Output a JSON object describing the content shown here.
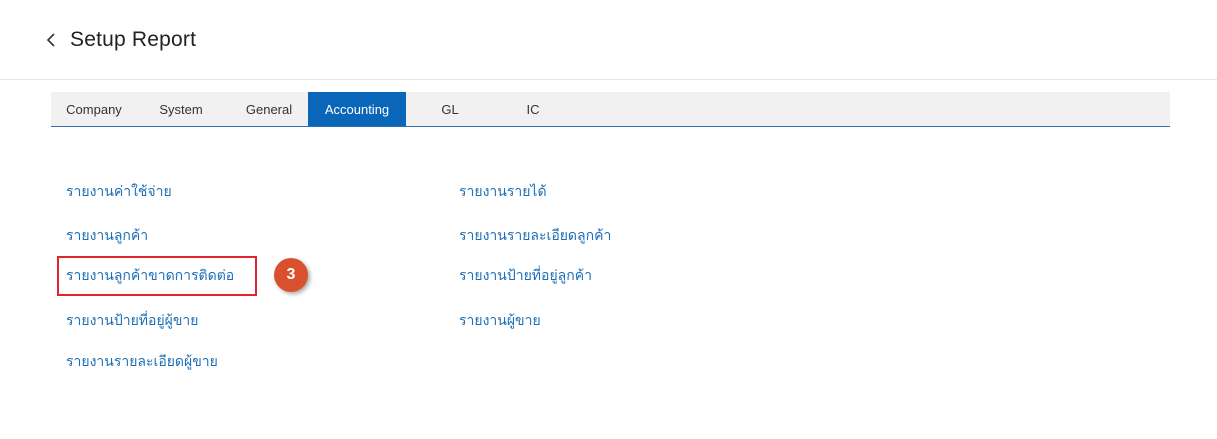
{
  "header": {
    "title": "Setup Report",
    "back_icon": "chevron-left-icon"
  },
  "tabs": [
    {
      "label": "Company",
      "active": false
    },
    {
      "label": "System",
      "active": false
    },
    {
      "label": "General",
      "active": false
    },
    {
      "label": "Accounting",
      "active": true
    },
    {
      "label": "GL",
      "active": false
    },
    {
      "label": "IC",
      "active": false
    }
  ],
  "reports": {
    "left": [
      "รายงานค่าใช้จ่าย",
      "รายงานลูกค้า",
      "รายงานลูกค้าขาดการติดต่อ",
      "รายงานป้ายที่อยู่ผู้ขาย",
      "รายงานรายละเอียดผู้ขาย"
    ],
    "right": [
      "รายงานรายได้",
      "รายงานรายละเอียดลูกค้า",
      "รายงานป้ายที่อยู่ลูกค้า",
      "รายงานผู้ขาย"
    ]
  },
  "annotation": {
    "step_number": "3",
    "highlight_color": "#e0232f",
    "badge_color": "#d9512c"
  },
  "colors": {
    "accent": "#0a66b8",
    "link": "#1c6fb6"
  }
}
